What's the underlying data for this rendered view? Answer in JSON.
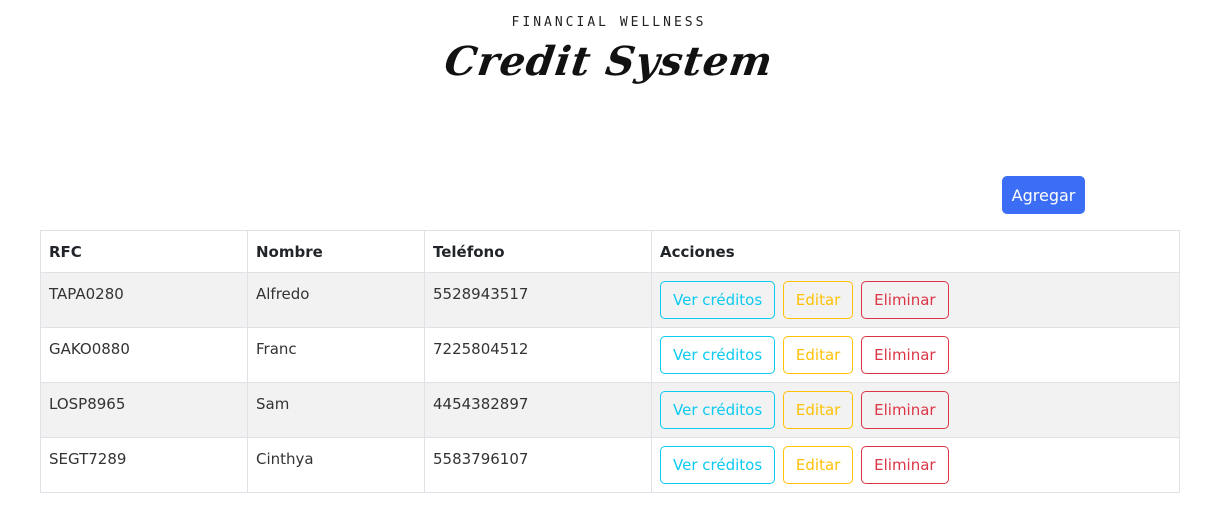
{
  "header": {
    "subtitle": "FINANCIAL WELLNESS",
    "brand": "Credit System"
  },
  "toolbar": {
    "add_label": "Agregar"
  },
  "table": {
    "columns": [
      "RFC",
      "Nombre",
      "Teléfono",
      "Acciones"
    ],
    "rows": [
      {
        "rfc": "TAPA0280",
        "nombre": "Alfredo",
        "telefono": "5528943517"
      },
      {
        "rfc": "GAKO0880",
        "nombre": "Franc",
        "telefono": "7225804512"
      },
      {
        "rfc": "LOSP8965",
        "nombre": "Sam",
        "telefono": "4454382897"
      },
      {
        "rfc": "SEGT7289",
        "nombre": "Cinthya",
        "telefono": "5583796107"
      }
    ],
    "actions": {
      "view_label": "Ver créditos",
      "edit_label": "Editar",
      "delete_label": "Eliminar"
    }
  },
  "colors": {
    "primary": "#3b6ef5",
    "info": "#0dcaf0",
    "warning": "#ffc107",
    "danger": "#dc3545",
    "row_stripe": "#f2f2f2"
  }
}
